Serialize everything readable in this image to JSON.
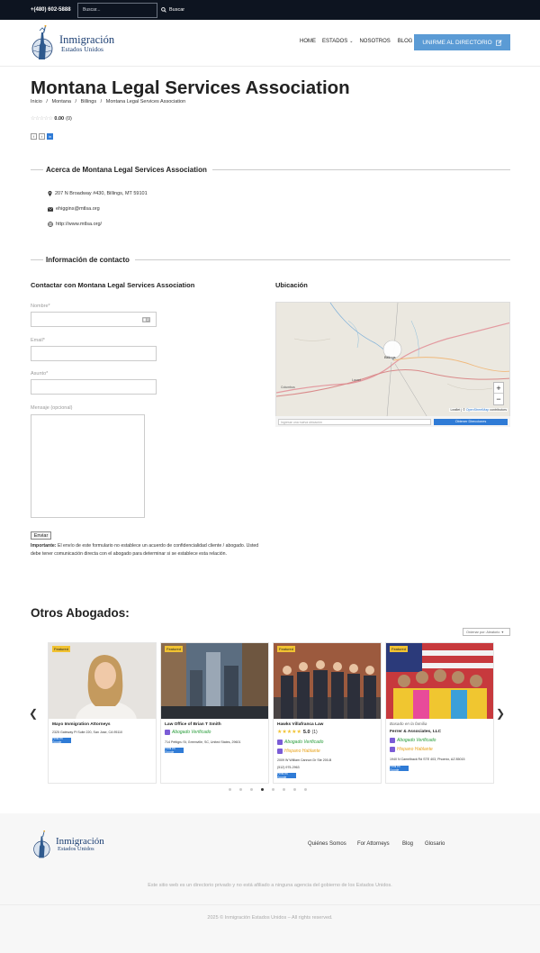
{
  "topbar": {
    "phone": "+(480) 602-5888",
    "search_placeholder": "Buscar...",
    "search_label": "Buscar"
  },
  "logo": {
    "line1": "Inmigración",
    "line2": "Estados Unidos"
  },
  "nav": {
    "items": [
      "HOME",
      "ESTADOS",
      "NOSOTROS",
      "BLOG"
    ],
    "join_label": "UNIRME AL DIRECTORIO"
  },
  "page": {
    "title": "Montana Legal Services Association",
    "breadcrumbs": [
      "Inicio",
      "Montana",
      "Billings",
      "Montana Legal Services Association"
    ],
    "rating_value": "0.00",
    "rating_count": "(0)"
  },
  "about": {
    "heading": "Acerca de Montana Legal Services Association",
    "address": "207 N Broadway #430, Billings, MT 59101",
    "email": "ehiggins@mtlsa.org",
    "website": "http://www.mtlsa.org/"
  },
  "contact": {
    "heading": "Información de contacto",
    "form_title": "Contactar con Montana Legal Services Association",
    "name_label": "Nombre*",
    "email_label": "Email*",
    "subject_label": "Asunto*",
    "message_label": "Mensaje (opcional)",
    "send_label": "Enviar",
    "notice_bold": "Importante:",
    "notice_text": "El envío de este formulario no establece un acuerdo de confidencialidad cliente / abogado. Usted debe tener comunicación directa con el abogado para determinar si se establece esta relación."
  },
  "location": {
    "title": "Ubicación",
    "zoom_in": "+",
    "zoom_out": "−",
    "attribution_prefix": "Leaflet | ©",
    "attribution_link": "OpenStreetMap",
    "attribution_suffix": "contributors",
    "dir_placeholder": "Ingresar una nueva ubicación",
    "dir_button": "Obtener Direcciones",
    "map_labels": {
      "city": "Billings",
      "town1": "Columbus",
      "town2": "Laurel"
    }
  },
  "others": {
    "heading": "Otros Abogados:",
    "order_label": "Ordenar por: Aleatorio",
    "cards": [
      {
        "featured": "Featured",
        "name": "Mayo Immigration Attorneys",
        "address": "2325 Gateway Pl Suite 220, San Jose, CA 95110",
        "google": "Perfil en Google"
      },
      {
        "featured": "Featured",
        "name": "Law Office of Brian T Smith",
        "verified": "Abogado Verificado",
        "address": "714 Pettigru St, Greenville, SC, United States, 29601",
        "google": "Perfil en Google"
      },
      {
        "featured": "Featured",
        "name": "Hawks Villafranca Law",
        "rating": "5.0",
        "reviews": "(1)",
        "verified": "Abogado Verificado",
        "hispanic": "Hispano Hablante",
        "address": "2009 W William Cannon Dr Ste 200-B",
        "phone": "(512) 975-2963",
        "google": "Perfil en Google"
      },
      {
        "featured": "Featured",
        "based": "Basado en la familia",
        "name": "Ferrer & Associates, LLC",
        "verified": "Abogado Verificado",
        "hispanic": "Hispano Hablante",
        "address": "1940 N Camelback Rd STE 403, Phoenix, AZ 85015",
        "google": "Perfil en Google"
      }
    ]
  },
  "footer": {
    "links": [
      "Quiénes Somos",
      "For Attorneys",
      "Blog",
      "Glosario"
    ],
    "note": "Este sitio web es un directorio privado y no está afiliado a ninguna agencia del gobierno de los Estados Unidos.",
    "copyright": "2025 © Inmigración Estados Unidos – All rights reserved."
  },
  "colors": {
    "topbar": "#0d1420",
    "join": "#5b9bd5",
    "brand": "#1c3f73",
    "verified": "#2a9d3c",
    "hispanic": "#e8a21a",
    "google": "#2f7bd6"
  }
}
